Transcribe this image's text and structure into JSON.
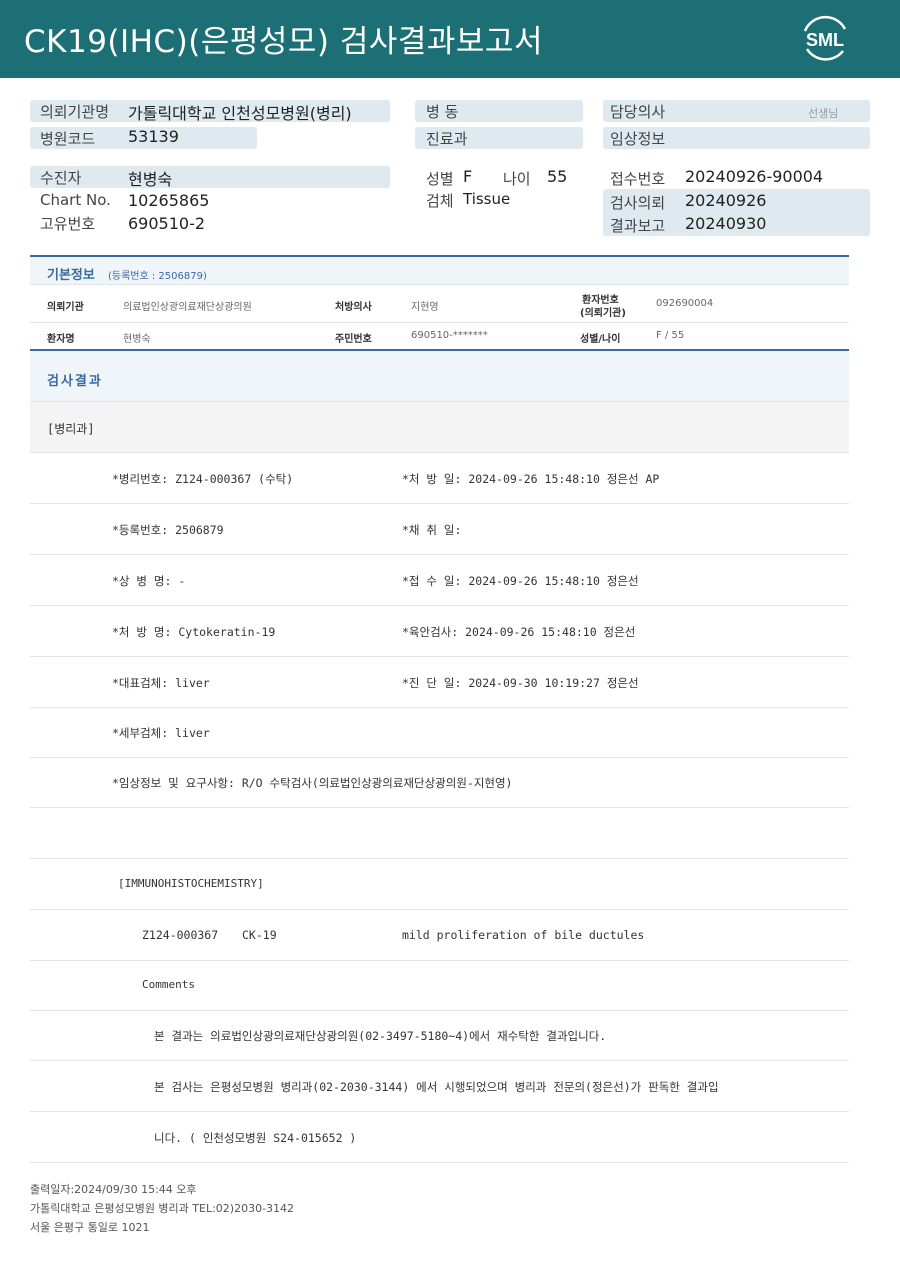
{
  "header": {
    "title": "CK19(IHC)(은평성모) 검사결과보고서",
    "logo_text": "SML"
  },
  "info": {
    "request_org_label": "의뢰기관명",
    "request_org_value": "가톨릭대학교 인천성모병원(병리)",
    "hospital_code_label": "병원코드",
    "hospital_code_value": "53139",
    "ward_label": "병 동",
    "dept_label": "진료과",
    "doctor_label": "담당의사",
    "doctor_suffix": "선생님",
    "clinical_label": "임상정보",
    "patient_label": "수진자",
    "patient_value": "현병숙",
    "chart_label": "Chart No.",
    "chart_value": "10265865",
    "unique_label": "고유번호",
    "unique_value": "690510-2",
    "sex_label": "성별",
    "sex_value": "F",
    "age_label": "나이",
    "age_value": "55",
    "specimen_label": "검체",
    "specimen_value": "Tissue",
    "receipt_label": "접수번호",
    "receipt_value": "20240926-90004",
    "test_req_label": "검사의뢰",
    "test_req_value": "20240926",
    "result_label": "결과보고",
    "result_value": "20240930"
  },
  "basic": {
    "title": "기본정보",
    "sub": "(등록번호 : 2506879)",
    "row1": {
      "org_label": "의뢰기관",
      "org_value": "의료법인상광의료재단상광의원",
      "doctor_label": "처방의사",
      "doctor_value": "지현영",
      "patno_label1": "환자번호",
      "patno_label2": "(의뢰기관)",
      "patno_value": "092690004"
    },
    "row2": {
      "name_label": "환자명",
      "name_value": "현병숙",
      "rrn_label": "주민번호",
      "rrn_value": "690510-*******",
      "sexage_label": "성별/나이",
      "sexage_value": "F / 55"
    }
  },
  "results": {
    "title": "검사결과",
    "dept": "[병리과]",
    "lines": [
      {
        "left": "*병리번호: Z124-000367 (수탁)",
        "right": "*처 방 일: 2024-09-26 15:48:10  정은선 AP"
      },
      {
        "left": "*등록번호: 2506879",
        "right": "*채 취 일:"
      },
      {
        "left": "*상 병 명: -",
        "right": "*접 수 일: 2024-09-26 15:48:10  정은선"
      },
      {
        "left": "*처 방 명: Cytokeratin-19",
        "right": "*육안검사: 2024-09-26 15:48:10  정은선"
      },
      {
        "left": "*대표검체: liver",
        "right": "*진 단 일: 2024-09-30 10:19:27  정은선"
      },
      {
        "left": "*세부검체: liver",
        "right": ""
      },
      {
        "left": "*임상정보 및 요구사항: R/O 수탁검사(의료법인상광의료재단상광의원-지현영)",
        "right": ""
      }
    ],
    "ihc_title": "[IMMUNOHISTOCHEMISTRY]",
    "ihc_id": "Z124-000367",
    "ihc_marker": "CK-19",
    "ihc_result": "mild proliferation of bile ductules",
    "comments_label": "Comments",
    "comment1": "본 결과는 의료법인상광의료재단상광의원(02-3497-5180~4)에서 재수탁한 결과입니다.",
    "comment2": "본 검사는 은평성모병원 병리과(02-2030-3144) 에서 시행되었으며 병리과 전문의(정은선)가 판독한 결과입",
    "comment3": "니다. ( 인천성모병원 S24-015652 )"
  },
  "footer": {
    "printed": "출력일자:2024/09/30 15:44 오후",
    "org": "가톨릭대학교 은평성모병원 병리과 TEL:02)2030-3142",
    "address": "서울 은평구 통일로 1021"
  },
  "colors": {
    "header_bg": "#1d6f76",
    "accent": "#3b6aa0",
    "info_bar": "#dfe9f0"
  }
}
